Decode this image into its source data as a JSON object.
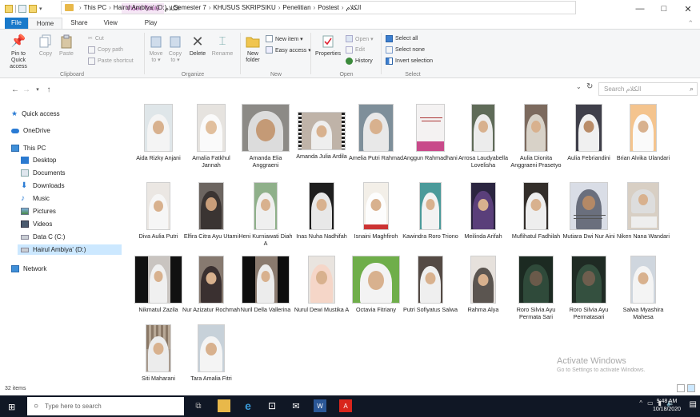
{
  "window": {
    "context_tab": "Video Tools",
    "title": "الكلام",
    "controls": {
      "minimize": "—",
      "maximize": "□",
      "close": "✕"
    }
  },
  "tabs": [
    {
      "label": "File"
    },
    {
      "label": "Home"
    },
    {
      "label": "Share"
    },
    {
      "label": "View"
    },
    {
      "label": "Play"
    }
  ],
  "ribbon": {
    "clipboard": {
      "label": "Clipboard",
      "pin_label": "Pin to Quick access",
      "copy_label": "Copy",
      "paste_label": "Paste",
      "cut_label": "Cut",
      "copy_path_label": "Copy path",
      "paste_shortcut_label": "Paste shortcut"
    },
    "organize": {
      "label": "Organize",
      "move_label": "Move to ▾",
      "copy_label": "Copy to ▾",
      "delete_label": "Delete",
      "rename_label": "Rename"
    },
    "new": {
      "label": "New",
      "new_item_label": "New item ▾",
      "easy_access_label": "Easy access ▾",
      "new_folder_label": "New folder"
    },
    "open": {
      "label": "Open",
      "properties_label": "Properties",
      "open_label": "Open ▾",
      "edit_label": "Edit",
      "history_label": "History"
    },
    "select": {
      "label": "Select",
      "select_all_label": "Select all",
      "select_none_label": "Select none",
      "invert_label": "Invert selection"
    }
  },
  "address": {
    "crumbs": [
      "This PC",
      "Hairul Ambiya' (D:)",
      "Semester 7",
      "KHUSUS SKRIPSIKU",
      "Penelitian",
      "Postest",
      "الكلام"
    ],
    "search_placeholder": "Search الكلام"
  },
  "nav": {
    "items": [
      {
        "label": "Quick access"
      },
      {
        "label": "OneDrive"
      },
      {
        "label": "This PC"
      },
      {
        "label": "Desktop"
      },
      {
        "label": "Documents"
      },
      {
        "label": "Downloads"
      },
      {
        "label": "Music"
      },
      {
        "label": "Pictures"
      },
      {
        "label": "Videos"
      },
      {
        "label": "Data C (C:)"
      },
      {
        "label": "Hairul Ambiya' (D:)"
      },
      {
        "label": "Network"
      }
    ]
  },
  "files": [
    {
      "name": "Aida Rizky Anjani"
    },
    {
      "name": "Amalia Fatkhul Jannah"
    },
    {
      "name": "Amanda Elia Anggraeni"
    },
    {
      "name": "Amanda Julia Ardila"
    },
    {
      "name": "Amelia Putri Rahmad"
    },
    {
      "name": "Anggun Rahmadhani"
    },
    {
      "name": "Arrosa Laudyabella Lovelisha"
    },
    {
      "name": "Aulia Dionita Anggraeni Prasetyo"
    },
    {
      "name": "Aulia Febriandini"
    },
    {
      "name": "Brian Alvika Ulandari"
    },
    {
      "name": "Diva Aulia Putri"
    },
    {
      "name": "Elfira Citra Ayu Utami"
    },
    {
      "name": "Heni Kurniawati Diah A"
    },
    {
      "name": "Inas Nuha Nadhifah"
    },
    {
      "name": "Isnaini Maghfiroh"
    },
    {
      "name": "Kawindra Roro Triono"
    },
    {
      "name": "Meilinda Arifah"
    },
    {
      "name": "Muflihatul Fadhilah"
    },
    {
      "name": "Mutiara Dwi Nur Aini"
    },
    {
      "name": "Niken Nana Wandari"
    },
    {
      "name": "Nikmatul Zazila"
    },
    {
      "name": "Nur Azizatur Rochmah"
    },
    {
      "name": "Nuril Della Vallerina"
    },
    {
      "name": "Nurul Dewi Mustika A"
    },
    {
      "name": "Octavia Fitriany"
    },
    {
      "name": "Putri Sofiyatus Salwa"
    },
    {
      "name": "Rahma Alya"
    },
    {
      "name": "Roro Silvia Ayu Permata Sari"
    },
    {
      "name": "Roro Silvia Ayu Permatasari"
    },
    {
      "name": "Salwa Myashira Mahesa"
    },
    {
      "name": "Siti Maharani"
    },
    {
      "name": "Tara Amalia Fitri"
    }
  ],
  "watermark": {
    "title": "Activate Windows",
    "subtitle": "Go to Settings to activate Windows."
  },
  "status": {
    "count": "32 items"
  },
  "taskbar": {
    "search_placeholder": "Type here to search",
    "time": "9:48 AM",
    "date": "10/18/2020"
  },
  "colors": {
    "accent": "#1979ca",
    "taskbar": "#101725",
    "selection": "#cce8ff",
    "context_tab": "#9c3c9c"
  }
}
